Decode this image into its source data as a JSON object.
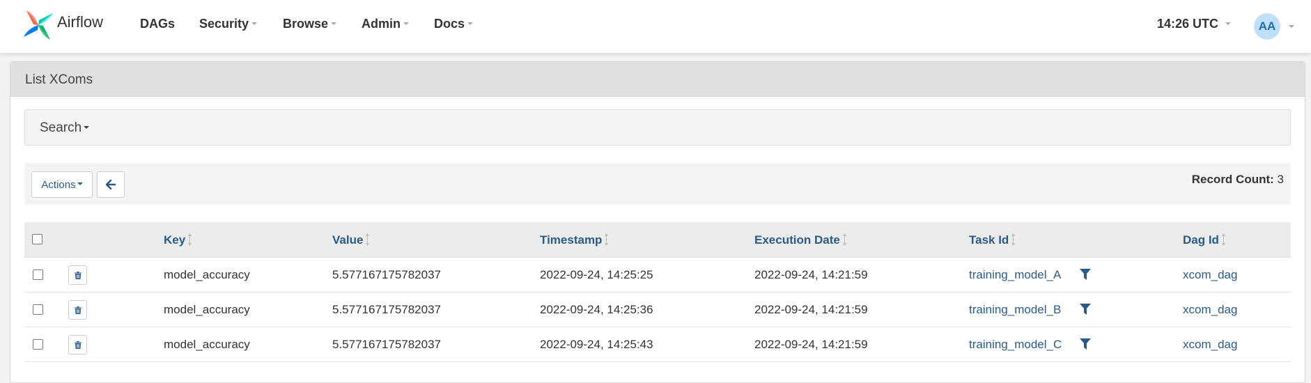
{
  "navbar": {
    "brand": "Airflow",
    "items": [
      {
        "label": "DAGs",
        "dropdown": false
      },
      {
        "label": "Security",
        "dropdown": true
      },
      {
        "label": "Browse",
        "dropdown": true
      },
      {
        "label": "Admin",
        "dropdown": true
      },
      {
        "label": "Docs",
        "dropdown": true
      }
    ],
    "clock": "14:26 UTC",
    "avatar": "AA"
  },
  "panel": {
    "title": "List XComs",
    "search_label": "Search",
    "actions_label": "Actions",
    "record_count_label": "Record Count:",
    "record_count": "3"
  },
  "table": {
    "columns": [
      "Key",
      "Value",
      "Timestamp",
      "Execution Date",
      "Task Id",
      "Dag Id"
    ],
    "rows": [
      {
        "key": "model_accuracy",
        "value": "5.577167175782037",
        "timestamp": "2022-09-24, 14:25:25",
        "execution_date": "2022-09-24, 14:21:59",
        "task_id": "training_model_A",
        "dag_id": "xcom_dag"
      },
      {
        "key": "model_accuracy",
        "value": "5.577167175782037",
        "timestamp": "2022-09-24, 14:25:36",
        "execution_date": "2022-09-24, 14:21:59",
        "task_id": "training_model_B",
        "dag_id": "xcom_dag"
      },
      {
        "key": "model_accuracy",
        "value": "5.577167175782037",
        "timestamp": "2022-09-24, 14:25:43",
        "execution_date": "2022-09-24, 14:21:59",
        "task_id": "training_model_C",
        "dag_id": "xcom_dag"
      }
    ]
  },
  "colors": {
    "link": "#2a5b88",
    "avatar_bg": "#bfe0f8",
    "header_bg": "#e0e0e0"
  },
  "icons": {
    "logo": "airflow-pinwheel-icon",
    "back": "arrow-left-icon",
    "delete": "trash-icon",
    "filter": "filter-icon",
    "sort": "sort-icon"
  }
}
